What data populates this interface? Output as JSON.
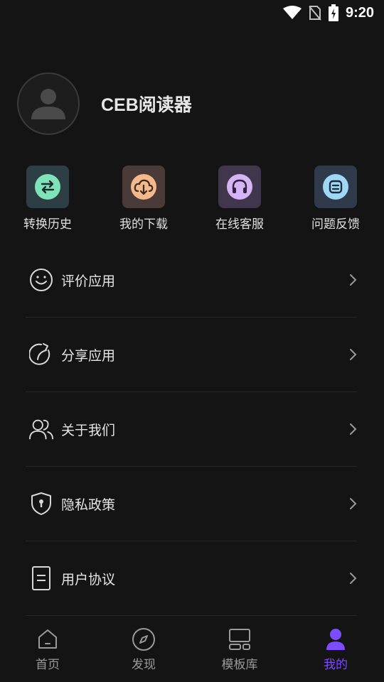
{
  "status_bar": {
    "time": "9:20"
  },
  "profile": {
    "app_name": "CEB阅读器"
  },
  "quick_actions": [
    {
      "label": "转换历史",
      "icon": "swap-icon",
      "bg": "#2d3e45",
      "fg": "#7ee3b8"
    },
    {
      "label": "我的下载",
      "icon": "cloud-download-icon",
      "bg": "#4a3b39",
      "fg": "#f3b98a"
    },
    {
      "label": "在线客服",
      "icon": "headset-icon",
      "bg": "#40374d",
      "fg": "#d5b4f5"
    },
    {
      "label": "问题反馈",
      "icon": "feedback-icon",
      "bg": "#2f3a4c",
      "fg": "#9fd8f5"
    }
  ],
  "menu": [
    {
      "label": "评价应用",
      "icon": "smile-icon"
    },
    {
      "label": "分享应用",
      "icon": "share-icon"
    },
    {
      "label": "关于我们",
      "icon": "users-icon"
    },
    {
      "label": "隐私政策",
      "icon": "shield-icon"
    },
    {
      "label": "用户协议",
      "icon": "document-icon"
    }
  ],
  "tabs": [
    {
      "label": "首页",
      "icon": "home-icon",
      "active": false
    },
    {
      "label": "发现",
      "icon": "compass-icon",
      "active": false
    },
    {
      "label": "模板库",
      "icon": "template-icon",
      "active": false
    },
    {
      "label": "我的",
      "icon": "person-icon",
      "active": true
    }
  ],
  "colors": {
    "accent": "#7b4dff",
    "background": "#141414"
  }
}
